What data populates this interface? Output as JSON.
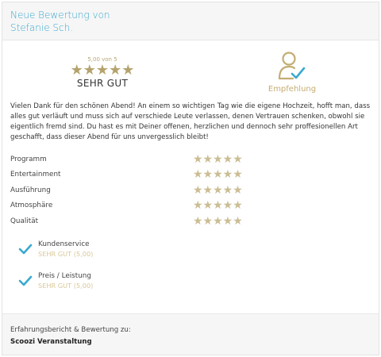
{
  "header": {
    "title_line1": "Neue Bewertung von",
    "title_line2": "Stefanie Sch."
  },
  "overall": {
    "score_text": "5,00 von 5",
    "stars": "★★★★★",
    "label": "SEHR GUT"
  },
  "recommendation": {
    "label": "Empfehlung",
    "icon": "person-check-icon"
  },
  "review_text": "Vielen Dank für den schönen Abend! An einem so wichtigen Tag wie die eigene Hochzeit, hofft man, dass alles gut verläuft und muss sich auf verschiede Leute verlassen, denen Vertrauen schenken, obwohl sie eigentlich fremd sind. Du hast es mit Deiner offenen, herzlichen und dennoch sehr proffesionellen Art geschafft, dass dieser Abend für uns unvergesslich bleibt!",
  "ratings": [
    {
      "label": "Programm",
      "stars": "★★★★★",
      "value": 5
    },
    {
      "label": "Entertainment",
      "stars": "★★★★★",
      "value": 5
    },
    {
      "label": "Ausführung",
      "stars": "★★★★★",
      "value": 5
    },
    {
      "label": "Atmosphäre",
      "stars": "★★★★★",
      "value": 5
    },
    {
      "label": "Qualität",
      "stars": "★★★★★",
      "value": 5
    }
  ],
  "badges": [
    {
      "name": "Kundenservice",
      "value": "SEHR GUT (5,00)"
    },
    {
      "name": "Preis / Leistung",
      "value": "SEHR GUT (5,00)"
    }
  ],
  "footer": {
    "label": "Erfahrungsbericht & Bewertung zu:",
    "name": "Scoozi Veranstaltung"
  },
  "colors": {
    "accent_blue": "#3aa9cf",
    "gold": "#b5a26d",
    "gold_light": "#cbbd93",
    "check_blue": "#3aa9cf"
  }
}
